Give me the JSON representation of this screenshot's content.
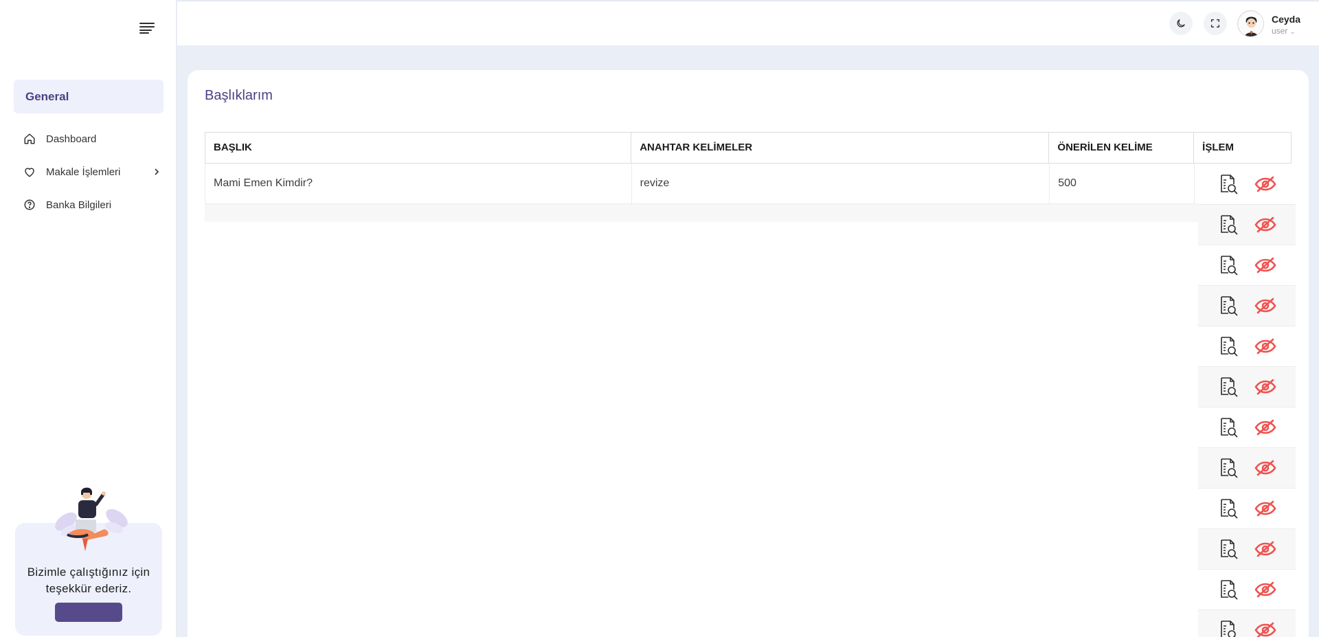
{
  "sidebar": {
    "section_label": "General",
    "items": [
      {
        "label": "Dashboard",
        "icon": "home-icon"
      },
      {
        "label": "Makale İşlemleri",
        "icon": "heart-icon",
        "has_submenu": true
      },
      {
        "label": "Banka Bilgileri",
        "icon": "question-circle-icon"
      }
    ],
    "promo": {
      "text_line1": "Bizimle çalıştığınız için",
      "text_line2": "teşekkür ederiz.",
      "button_label": ""
    }
  },
  "header": {
    "user": {
      "name": "Ceyda",
      "role": "user"
    }
  },
  "main": {
    "title": "Başlıklarım",
    "table": {
      "columns": [
        "BAŞLIK",
        "ANAHTAR KELİMELER",
        "ÖNERİLEN KELİME",
        "İŞLEM"
      ],
      "rows": [
        {
          "title": "Mami Emen Kimdir?",
          "keywords": "revize",
          "words": "500"
        }
      ]
    },
    "action_rows": 12
  },
  "colors": {
    "accent": "#4b3f82",
    "button": "#574a8b",
    "danger": "#ef5350"
  }
}
